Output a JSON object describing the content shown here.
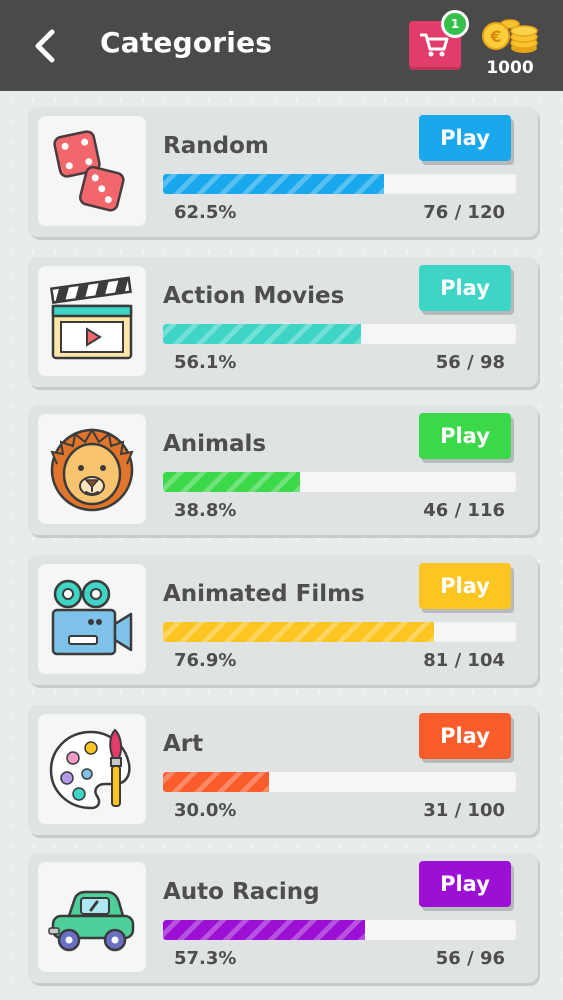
{
  "header": {
    "title": "Categories",
    "cart_badge": "1",
    "coins": "1000"
  },
  "categories": [
    {
      "name": "Random",
      "play_label": "Play",
      "color": "#1aa8ec",
      "progress_pct": 62.5,
      "progress_text": "62.5%",
      "count": "76 / 120",
      "icon": "dice-icon"
    },
    {
      "name": "Action Movies",
      "play_label": "Play",
      "color": "#3ed4c6",
      "progress_pct": 56.1,
      "progress_text": "56.1%",
      "count": "56 / 98",
      "icon": "clapperboard-icon"
    },
    {
      "name": "Animals",
      "play_label": "Play",
      "color": "#3bd849",
      "progress_pct": 38.8,
      "progress_text": "38.8%",
      "count": "46 / 116",
      "icon": "lion-icon"
    },
    {
      "name": "Animated Films",
      "play_label": "Play",
      "color": "#fcc521",
      "progress_pct": 76.9,
      "progress_text": "76.9%",
      "count": "81 / 104",
      "icon": "film-camera-icon"
    },
    {
      "name": "Art",
      "play_label": "Play",
      "color": "#fb5c2c",
      "progress_pct": 30.0,
      "progress_text": "30.0%",
      "count": "31 / 100",
      "icon": "palette-icon"
    },
    {
      "name": "Auto Racing",
      "play_label": "Play",
      "color": "#9c10d6",
      "progress_pct": 57.3,
      "progress_text": "57.3%",
      "count": "56 / 96",
      "icon": "car-icon"
    }
  ]
}
